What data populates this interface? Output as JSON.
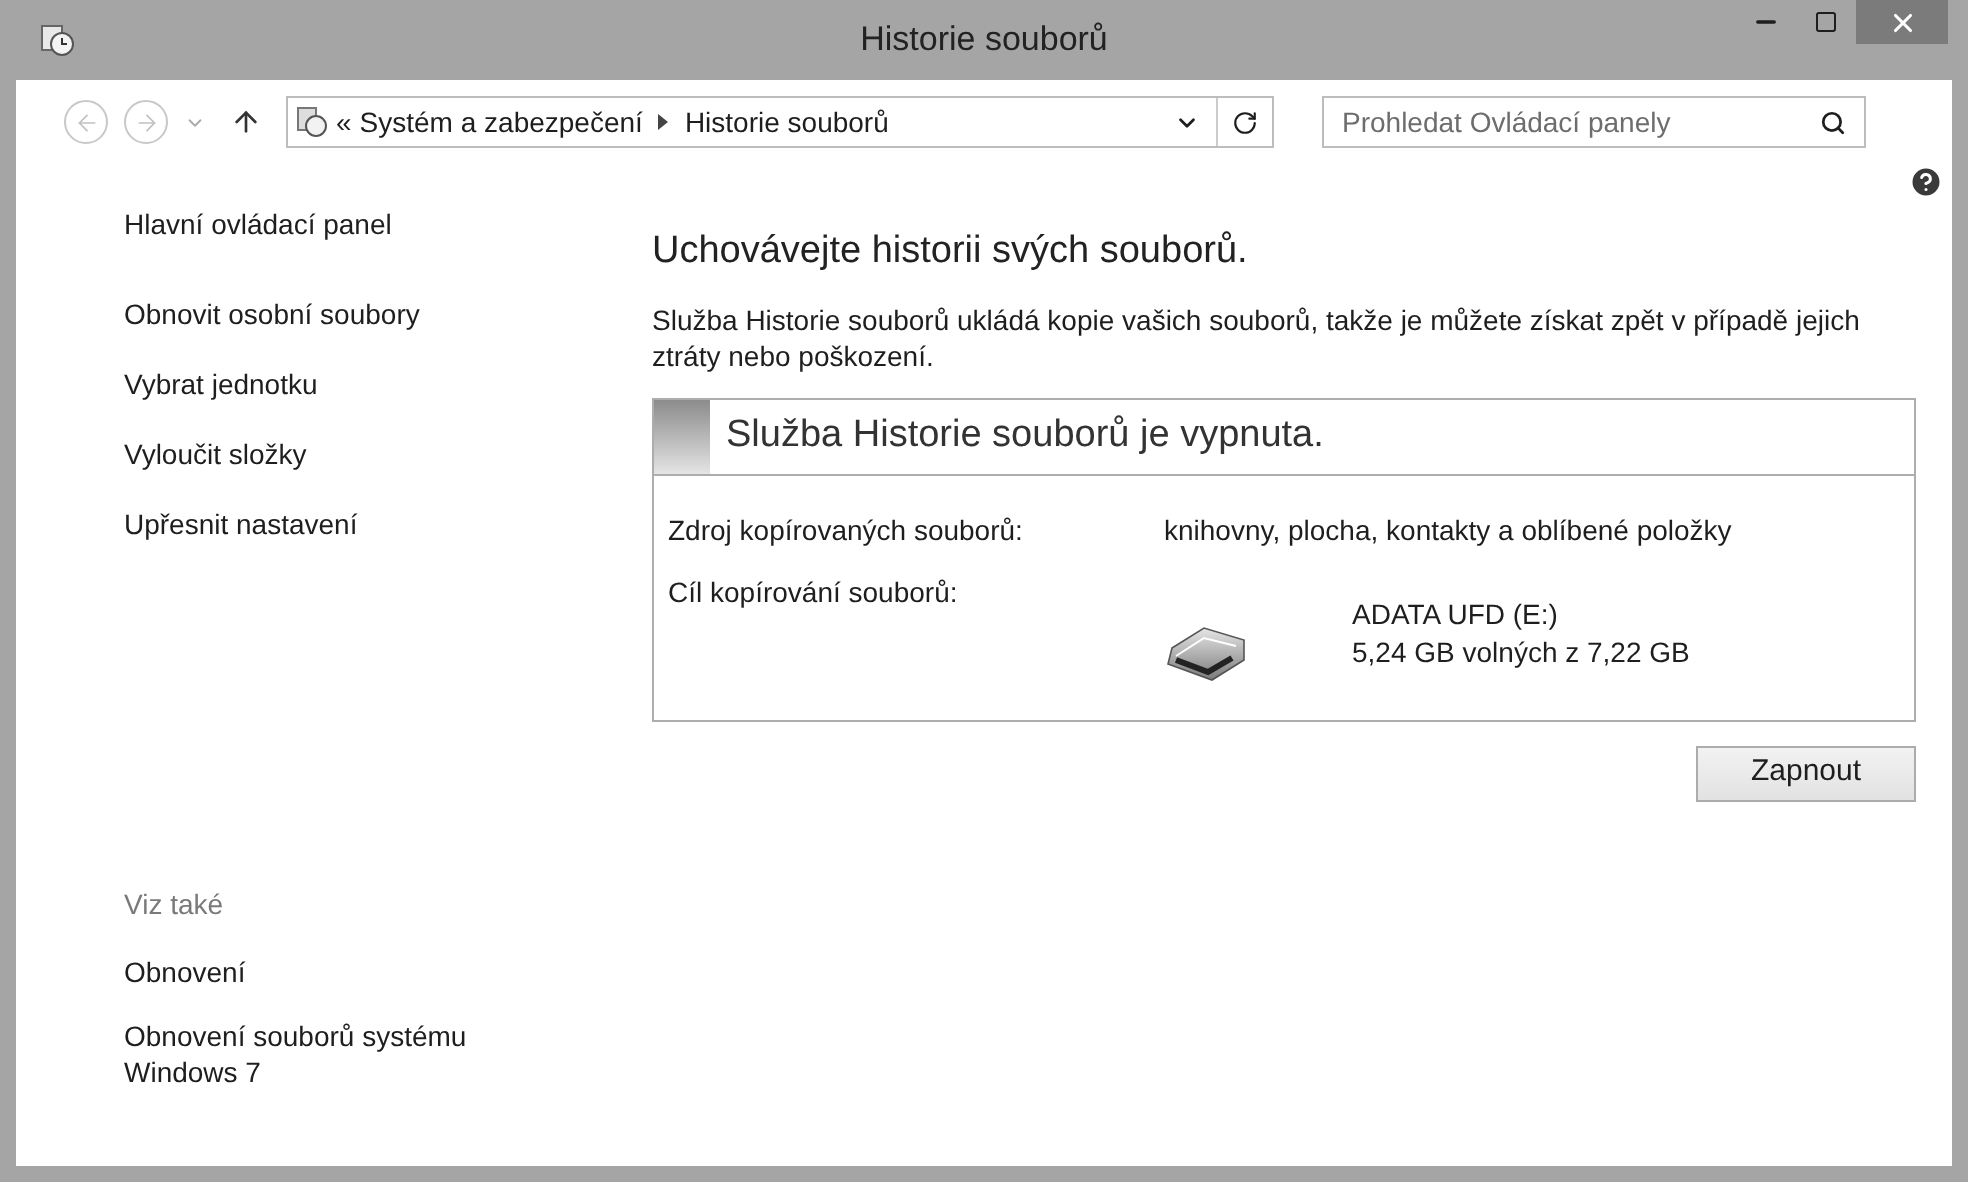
{
  "window": {
    "title": "Historie souborů"
  },
  "nav": [
    {
      "kind": "back",
      "disabled": true
    },
    {
      "kind": "forward",
      "disabled": true
    }
  ],
  "address": {
    "prefix": "«",
    "crumbs": [
      "Systém a zabezpečení",
      "Historie souborů"
    ]
  },
  "search": {
    "placeholder": "Prohledat Ovládací panely"
  },
  "sidebar": {
    "home": "Hlavní ovládací panel",
    "links": [
      "Obnovit osobní soubory",
      "Vybrat jednotku",
      "Vyloučit složky",
      "Upřesnit nastavení"
    ],
    "see_also": {
      "title": "Viz také",
      "links": [
        "Obnovení",
        "Obnovení souborů systému Windows 7"
      ]
    }
  },
  "main": {
    "heading": "Uchovávejte historii svých souborů.",
    "description": "Služba Historie souborů ukládá kopie vašich souborů, takže je můžete získat zpět v případě jejich ztráty nebo poškození.",
    "panel": {
      "title": "Služba Historie souborů je vypnuta.",
      "source_label": "Zdroj kopírovaných souborů:",
      "source_value": "knihovny, plocha, kontakty a oblíbené položky",
      "target_label": "Cíl kopírování souborů:",
      "drive_name": "ADATA UFD (E:)",
      "drive_space": "5,24 GB volných z 7,22 GB"
    },
    "button": "Zapnout"
  }
}
